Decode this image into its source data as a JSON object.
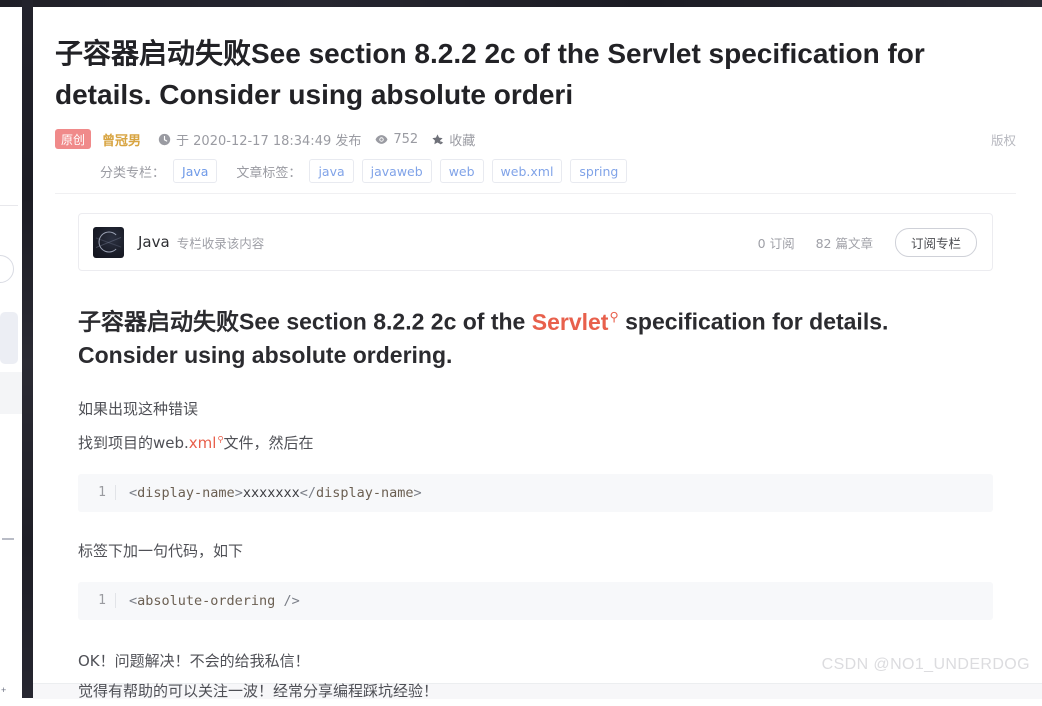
{
  "article": {
    "title": "子容器启动失败See section 8.2.2 2c of the Servlet specification for details. Consider using absolute orderi",
    "badge_original": "原创",
    "author": "曾冠男",
    "publish_text": "于 2020-12-17 18:34:49 发布",
    "views": "752",
    "collect_label": "收藏",
    "copyright_label": "版权"
  },
  "tags": {
    "category_label": "分类专栏：",
    "category_items": [
      "Java"
    ],
    "tag_label": "文章标签：",
    "tag_items": [
      "java",
      "javaweb",
      "web",
      "web.xml",
      "spring"
    ]
  },
  "column_card": {
    "name": "Java",
    "subtitle": "专栏收录该内容",
    "subscribers": "0 订阅",
    "articles": "82 篇文章",
    "subscribe_button": "订阅专栏"
  },
  "body": {
    "heading_part1": "子容器启动失败See section 8.2.2 2c of the ",
    "heading_keyword": "Servlet",
    "heading_part2": " specification for details. Consider using absolute ordering.",
    "p1": "如果出现这种错误",
    "p2_prefix": "找到项目的web.",
    "p2_keyword": "xml",
    "p2_suffix": "文件，然后在",
    "p3": "标签下加一句代码，如下",
    "p4": "OK！问题解决！不会的给我私信！",
    "p5": "觉得有帮助的可以关注一波！经常分享编程踩坑经验！"
  },
  "code_blocks": [
    {
      "line_number": "1",
      "open_lt": "<",
      "open_tag": "display-name",
      "open_gt": ">",
      "content": "xxxxxxx",
      "close_lt": "</",
      "close_tag": "display-name",
      "close_gt": ">"
    },
    {
      "line_number": "1",
      "open_lt": "<",
      "open_tag": "absolute-ordering",
      "close_gt": " />"
    }
  ],
  "watermark": "CSDN @NO1_UNDERDOG",
  "colors": {
    "accent_keyword": "#e8604c",
    "badge_bg": "#f08a8a",
    "author": "#d8a441",
    "tag_text": "#80a3e8"
  }
}
